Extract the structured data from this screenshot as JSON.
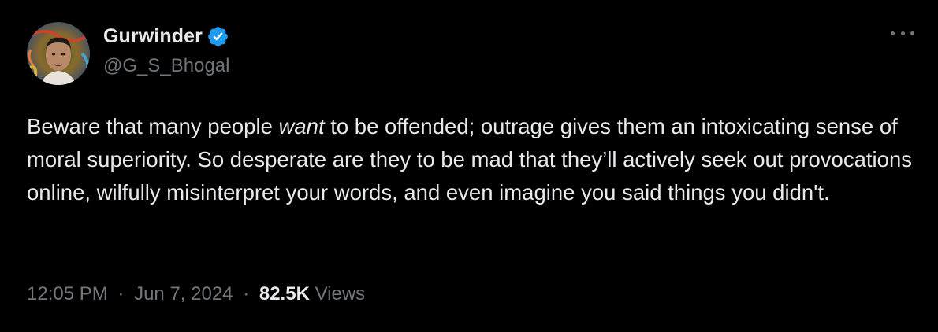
{
  "author": {
    "display_name": "Gurwinder",
    "handle": "@G_S_Bhogal",
    "verified": true,
    "verified_icon": "verified-badge-icon",
    "avatar_icon": "profile-photo"
  },
  "tweet": {
    "text_part1": "Beware that many people ",
    "text_emphasis": "want",
    "text_part2": " to be offended; outrage gives them an intoxicating sense of moral superiority. So desperate are they to be mad that they’ll actively seek out provocations online, wilfully misinterpret your words, and even imagine you said things you didn't.",
    "time": "12:05 PM",
    "date": "Jun 7, 2024",
    "views_count": "82.5K",
    "views_label": "Views",
    "separator": "·"
  },
  "menu": {
    "more_icon": "more-options-icon"
  },
  "colors": {
    "background": "#000000",
    "primary_text": "#e7e9ea",
    "secondary_text": "#71767b",
    "verified_blue": "#1d9bf0"
  }
}
